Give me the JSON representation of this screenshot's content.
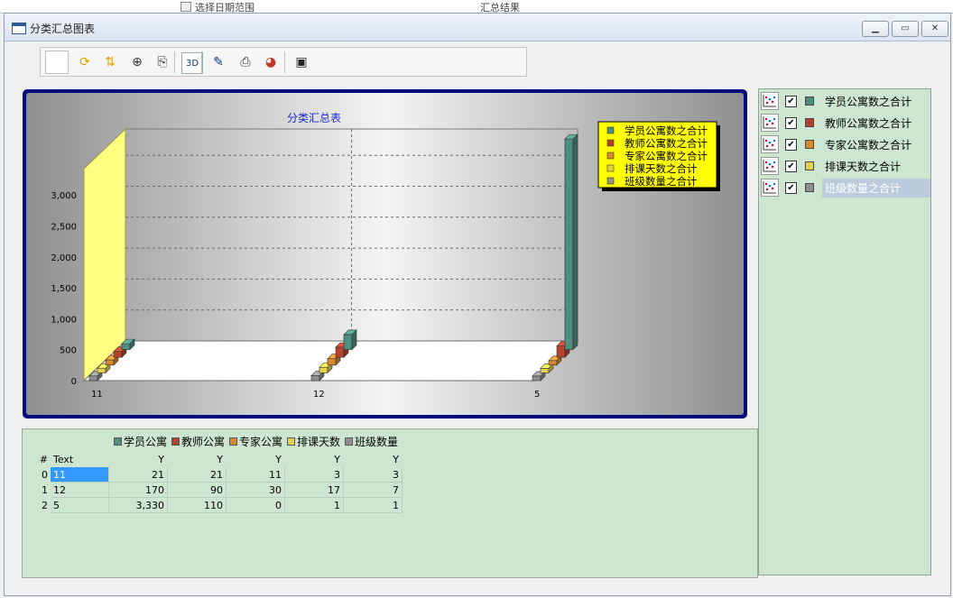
{
  "window": {
    "title": "分类汇总图表",
    "controls": [
      "minimize",
      "restore",
      "close"
    ]
  },
  "toolbar": {
    "buttons": [
      {
        "name": "gallery-button",
        "icon": "chart-gallery-icon",
        "glyph": ""
      },
      {
        "name": "refresh-button",
        "icon": "rotate-icon",
        "glyph": "⟳"
      },
      {
        "name": "axis-button",
        "icon": "axis-arrows-icon",
        "glyph": "⇅"
      },
      {
        "name": "zoom-button",
        "icon": "zoom-icon",
        "glyph": "⊕"
      },
      {
        "name": "copy-button",
        "icon": "copy-icon",
        "glyph": "⎘"
      },
      {
        "name": "3d-button",
        "icon": "3d-toggle-icon",
        "glyph": "3D"
      },
      {
        "name": "format-button",
        "icon": "ruler-pencil-icon",
        "glyph": "✎"
      },
      {
        "name": "print-button",
        "icon": "printer-icon",
        "glyph": "⎙"
      },
      {
        "name": "palette-button",
        "icon": "palette-icon",
        "glyph": "◕"
      },
      {
        "name": "save-button",
        "icon": "save-icon",
        "glyph": "▣"
      }
    ]
  },
  "chart_data": {
    "type": "bar",
    "title": "分类汇总表",
    "categories": [
      "11",
      "12",
      "5"
    ],
    "series": [
      {
        "name": "学员公寓数之合计",
        "color": "#4f8f7e",
        "values": [
          21,
          170,
          3330
        ]
      },
      {
        "name": "教师公寓数之合计",
        "color": "#b5432c",
        "values": [
          21,
          90,
          110
        ]
      },
      {
        "name": "专家公寓数之合计",
        "color": "#d8892e",
        "values": [
          11,
          30,
          0
        ]
      },
      {
        "name": "排课天数之合计",
        "color": "#e6d34a",
        "values": [
          3,
          17,
          1
        ]
      },
      {
        "name": "班级数量之合计",
        "color": "#8f8f8f",
        "values": [
          3,
          7,
          1
        ]
      }
    ],
    "yticks": [
      "0",
      "500",
      "1,000",
      "1,500",
      "2,000",
      "2,500",
      "3,000"
    ],
    "ylim": [
      0,
      3000
    ],
    "grid": true,
    "legend_position": "top-right",
    "three_d": true
  },
  "grid": {
    "legend_labels": [
      "学员公寓",
      "教师公寓",
      "专家公寓",
      "排课天数",
      "班级数量"
    ],
    "header": {
      "rownum": "#",
      "text": "Text",
      "value_header": "Y"
    },
    "rows": [
      {
        "n": "0",
        "text": "11",
        "values": [
          "21",
          "21",
          "11",
          "3",
          "3"
        ]
      },
      {
        "n": "1",
        "text": "12",
        "values": [
          "170",
          "90",
          "30",
          "17",
          "7"
        ]
      },
      {
        "n": "2",
        "text": "5",
        "values": [
          "3,330",
          "110",
          "0",
          "1",
          "1"
        ]
      }
    ]
  },
  "series_panel": {
    "items": [
      {
        "label": "学员公寓数之合计",
        "checked": true,
        "color": "#4f8f7e"
      },
      {
        "label": "教师公寓数之合计",
        "checked": true,
        "color": "#b5432c"
      },
      {
        "label": "专家公寓数之合计",
        "checked": true,
        "color": "#d8892e"
      },
      {
        "label": "排课天数之合计",
        "checked": true,
        "color": "#e6d34a"
      },
      {
        "label": "班级数量之合计",
        "checked": true,
        "color": "#8f8f8f",
        "selected": true
      }
    ]
  },
  "background_window": {
    "texts": [
      "选择日期范围",
      "汇总结果"
    ]
  }
}
